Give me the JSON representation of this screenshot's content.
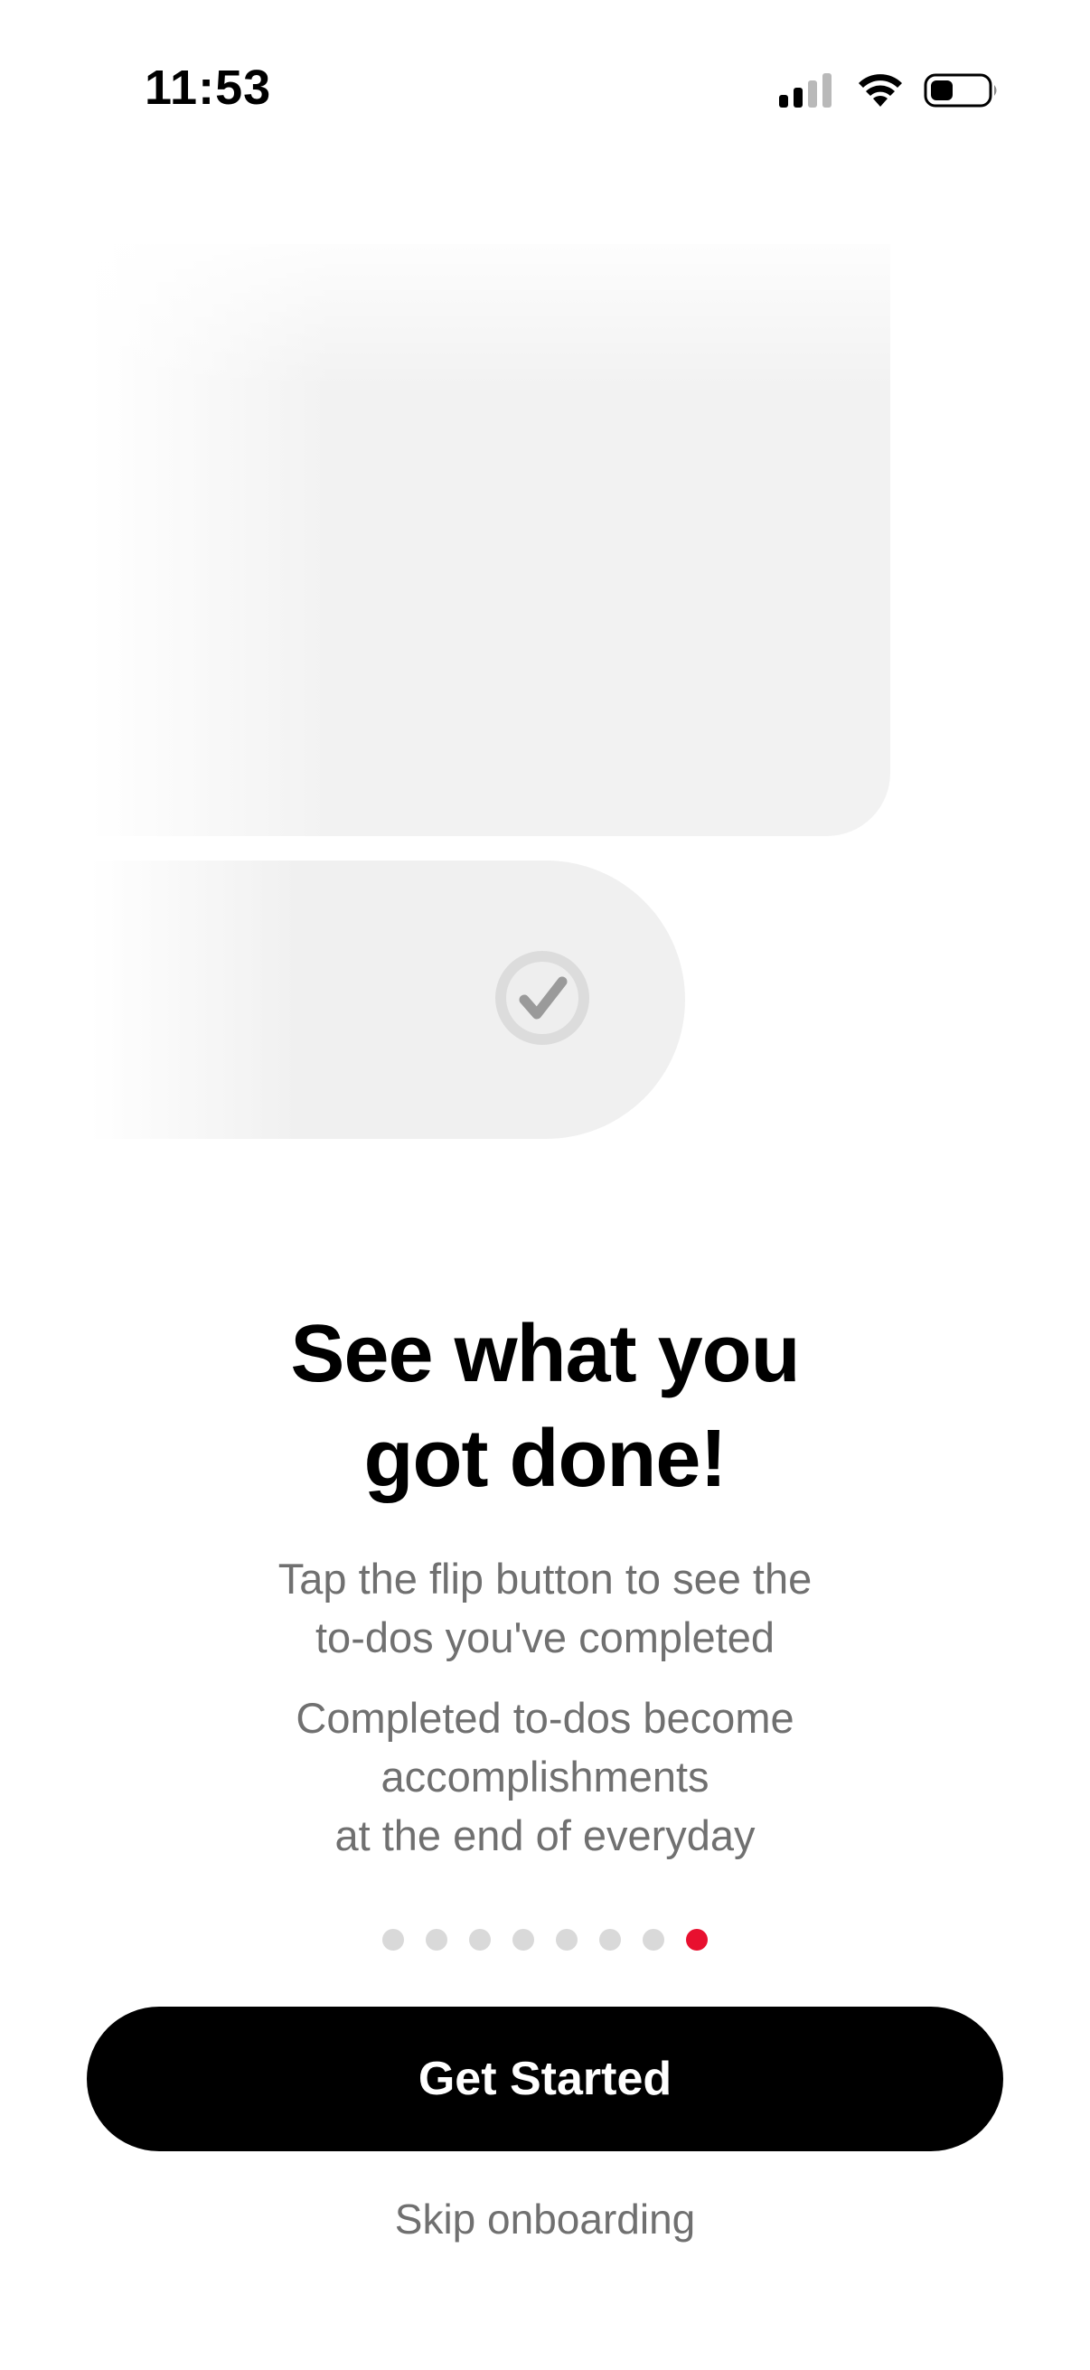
{
  "status_bar": {
    "time": "11:53",
    "icons": [
      "cellular-signal-icon",
      "wifi-icon",
      "battery-icon"
    ],
    "signal_bars_active": 2,
    "signal_bars_total": 4
  },
  "illustration": {
    "icons": [
      "checkmark-circle-icon"
    ]
  },
  "headline": {
    "line1": "See what you",
    "line2": "got done!"
  },
  "body": {
    "paragraph1": {
      "line1": "Tap the flip button to see the",
      "line2": "to-dos you've completed"
    },
    "paragraph2": {
      "line1": "Completed to-dos become",
      "line2": "accomplishments",
      "line3": "at the end of everyday"
    }
  },
  "pagination": {
    "total": 8,
    "current": 8,
    "active_color": "#e8102f",
    "inactive_color": "#d9d9d9"
  },
  "actions": {
    "primary_label": "Get Started",
    "skip_label": "Skip onboarding"
  },
  "colors": {
    "background": "#ffffff",
    "primary_button": "#000000",
    "secondary_text": "#707070",
    "accent": "#e8102f"
  }
}
